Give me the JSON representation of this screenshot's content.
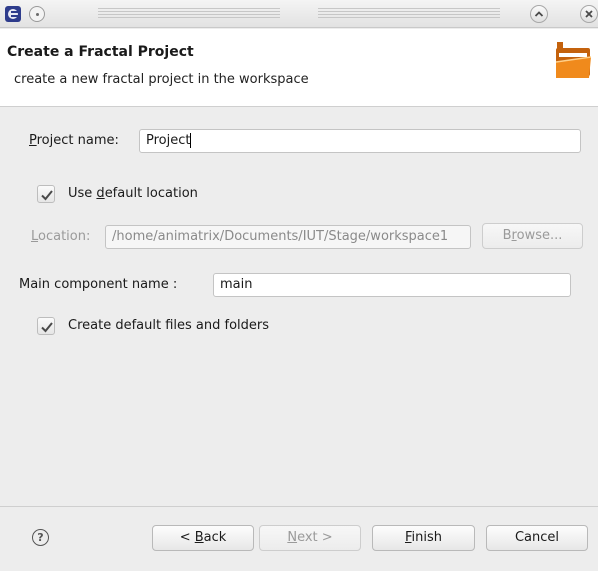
{
  "header": {
    "title": "Create a Fractal Project",
    "description": "create a new fractal project in the workspace"
  },
  "project_name": {
    "label_mnemonic": "P",
    "label_rest": "roject name:",
    "value": "Project"
  },
  "use_default_location": {
    "label_pre": "Use ",
    "label_mnemonic": "d",
    "label_post": "efault location",
    "checked": true
  },
  "location": {
    "label_mnemonic": "L",
    "label_rest": "ocation:",
    "value": "/home/animatrix/Documents/IUT/Stage/workspace1"
  },
  "browse_button": {
    "pre": "B",
    "mnemonic": "r",
    "post": "owse..."
  },
  "main_component": {
    "label": "Main component name :",
    "value": "main"
  },
  "create_default_files": {
    "label": "Create default files and folders",
    "checked": true
  },
  "buttons": {
    "back": {
      "pre": "< ",
      "mnemonic": "B",
      "post": "ack"
    },
    "next": {
      "mnemonic": "N",
      "post": "ext >"
    },
    "finish": {
      "mnemonic": "F",
      "post": "inish"
    },
    "cancel": "Cancel"
  },
  "icons": {
    "app": "eclipse-icon",
    "help": "help-icon",
    "banner": "folder-icon"
  },
  "colors": {
    "folder": "#f08a1c",
    "folder_dark": "#c4620d",
    "disabled_text": "#9a9a9a"
  }
}
